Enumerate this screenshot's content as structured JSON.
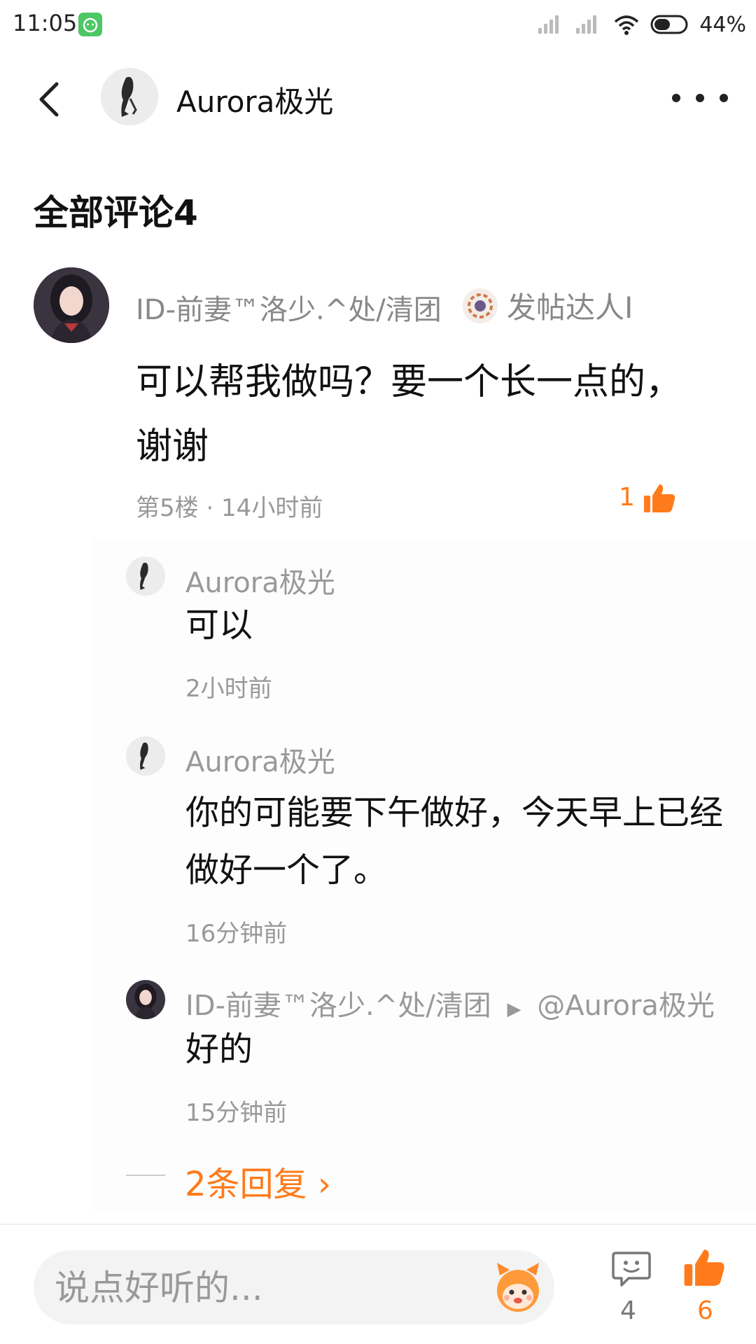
{
  "status": {
    "time": "11:05",
    "battery": "44%"
  },
  "header": {
    "title": "Aurora极光"
  },
  "section": {
    "title": "全部评论4"
  },
  "comment": {
    "username": "ID-前妻™洛少.^处/清团",
    "badge": "发帖达人I",
    "content": "可以帮我做吗？要一个长一点的，谢谢",
    "meta": "第5楼 · 14小时前",
    "likes": "1"
  },
  "replies": [
    {
      "name": "Aurora极光",
      "text": "可以",
      "time": "2小时前"
    },
    {
      "name": "Aurora极光",
      "text": "你的可能要下午做好，今天早上已经做好一个了。",
      "time": "16分钟前"
    },
    {
      "name": "ID-前妻™洛少.^处/清团",
      "reply_to": "@Aurora极光",
      "text": "好的",
      "time": "15分钟前"
    }
  ],
  "more_replies": "2条回复",
  "bottom": {
    "input_placeholder": "说点好听的...",
    "comment_count": "4",
    "like_count": "6"
  },
  "colors": {
    "accent": "#ff7a1a",
    "muted": "#999999"
  }
}
